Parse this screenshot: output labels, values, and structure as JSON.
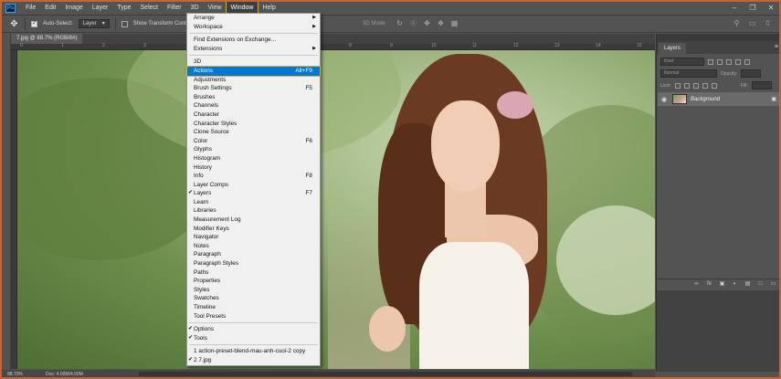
{
  "menubar": {
    "logo": "Ps",
    "items": [
      "File",
      "Edit",
      "Image",
      "Layer",
      "Type",
      "Select",
      "Filter",
      "3D",
      "View",
      "Window",
      "Help"
    ],
    "active": "Window"
  },
  "options": {
    "auto_select_label": "Auto-Select:",
    "auto_select_value": "Layer",
    "show_transform_label": "Show Transform Controls",
    "mode_3d_label": "3D Mode:"
  },
  "document": {
    "tab_label": "7.jpg @ 88.7% (RGB/8#)",
    "zoom": "88.73%",
    "doc_size": "Doc: 4.00M/4.00M"
  },
  "ruler_top": [
    "0",
    "1",
    "2",
    "3",
    "4",
    "5",
    "6",
    "7",
    "8",
    "9",
    "10",
    "11",
    "12",
    "13",
    "14",
    "15"
  ],
  "window_menu": {
    "groups": [
      [
        {
          "label": "Arrange",
          "submenu": true
        },
        {
          "label": "Workspace",
          "submenu": true
        }
      ],
      [
        {
          "label": "Find Extensions on Exchange..."
        },
        {
          "label": "Extensions",
          "submenu": true
        }
      ],
      [
        {
          "label": "3D"
        },
        {
          "label": "Actions",
          "shortcut": "Alt+F9",
          "highlighted": true
        },
        {
          "label": "Adjustments"
        },
        {
          "label": "Brush Settings",
          "shortcut": "F5"
        },
        {
          "label": "Brushes"
        },
        {
          "label": "Channels"
        },
        {
          "label": "Character"
        },
        {
          "label": "Character Styles"
        },
        {
          "label": "Clone Source"
        },
        {
          "label": "Color",
          "shortcut": "F6"
        },
        {
          "label": "Glyphs"
        },
        {
          "label": "Histogram"
        },
        {
          "label": "History"
        },
        {
          "label": "Info",
          "shortcut": "F8"
        },
        {
          "label": "Layer Comps"
        },
        {
          "label": "Layers",
          "shortcut": "F7",
          "checked": true
        },
        {
          "label": "Learn"
        },
        {
          "label": "Libraries"
        },
        {
          "label": "Measurement Log"
        },
        {
          "label": "Modifier Keys"
        },
        {
          "label": "Navigator"
        },
        {
          "label": "Notes"
        },
        {
          "label": "Paragraph"
        },
        {
          "label": "Paragraph Styles"
        },
        {
          "label": "Paths"
        },
        {
          "label": "Properties"
        },
        {
          "label": "Styles"
        },
        {
          "label": "Swatches"
        },
        {
          "label": "Timeline"
        },
        {
          "label": "Tool Presets"
        }
      ],
      [
        {
          "label": "Options",
          "checked": true
        },
        {
          "label": "Tools",
          "checked": true
        }
      ],
      [
        {
          "label": "1 action-preset-blend-mau-anh-cuoi-2 copy"
        },
        {
          "label": "2 7.jpg",
          "checked": true
        }
      ]
    ]
  },
  "layers_panel": {
    "tab": "Layers",
    "kind_placeholder": "Kind",
    "blend_mode": "Normal",
    "opacity_label": "Opacity:",
    "lock_label": "Lock:",
    "fill_label": "Fill:",
    "layer_name": "Background"
  },
  "colors": {
    "accent": "#0078d7",
    "highlight_border": "#e0b020",
    "frame_border": "#c1663a",
    "ui_bg": "#535353"
  }
}
